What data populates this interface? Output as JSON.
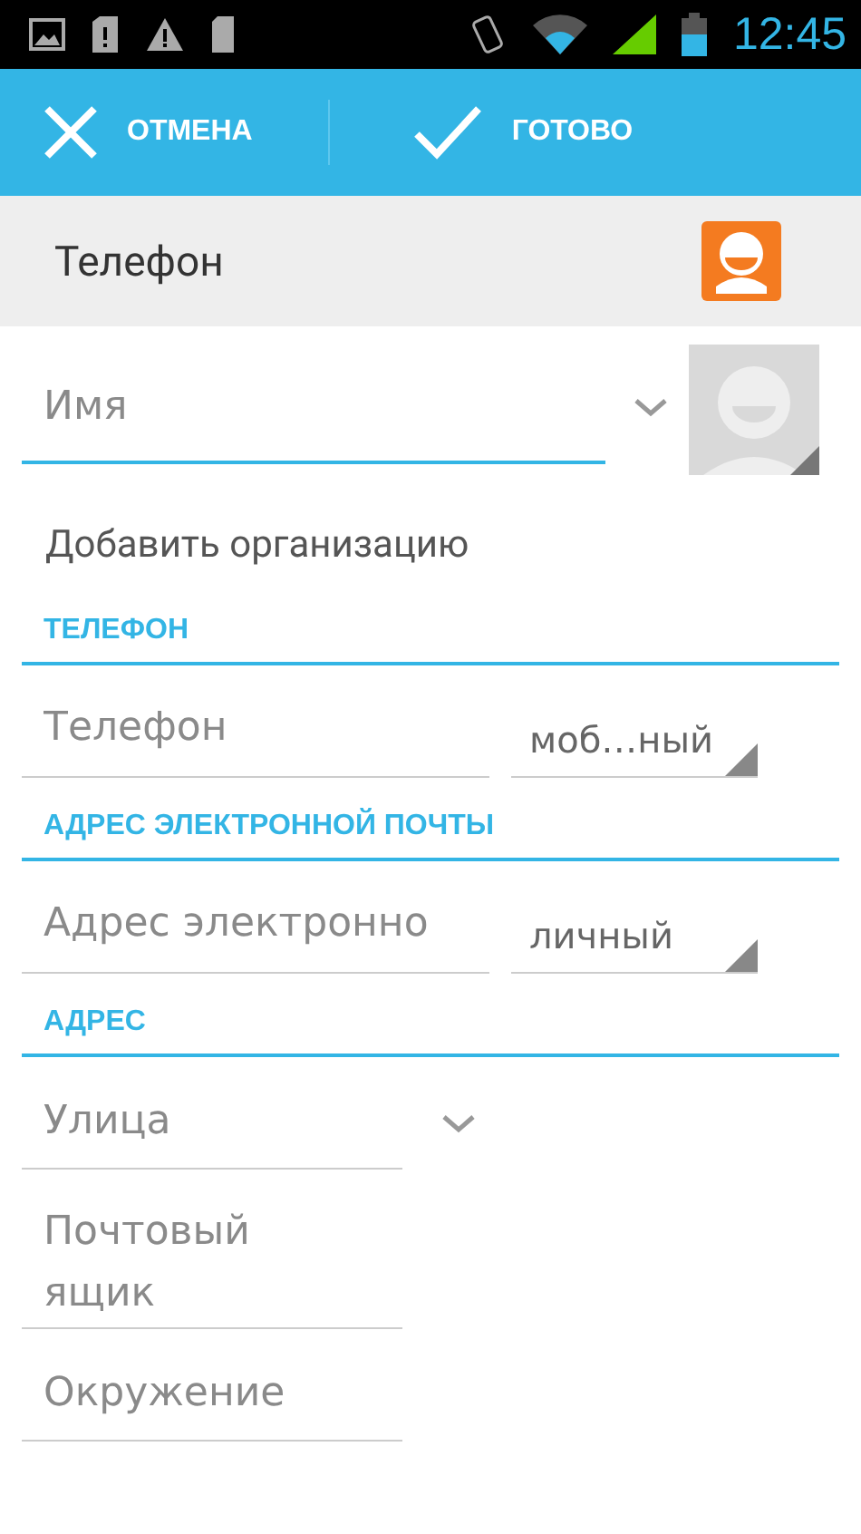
{
  "status_bar": {
    "time": "12:45"
  },
  "action_bar": {
    "cancel": "ОТМЕНА",
    "done": "ГОТОВО"
  },
  "account_header": {
    "title": "Телефон"
  },
  "name_field": {
    "placeholder": "Имя",
    "focused": true
  },
  "add_organization": "Добавить организацию",
  "sections": [
    {
      "title": "ТЕЛЕФОН",
      "fields": [
        {
          "kind": "spinner",
          "placeholder": "Телефон",
          "type": "моб…ный"
        }
      ]
    },
    {
      "title": "АДРЕС ЭЛЕКТРОННОЙ ПОЧТЫ",
      "fields": [
        {
          "kind": "spinner",
          "placeholder": "Адрес электронно",
          "type": "личный"
        }
      ]
    },
    {
      "title": "АДРЕС",
      "fields": [
        {
          "kind": "expand",
          "placeholder": "Улица"
        },
        {
          "kind": "multiline",
          "placeholder": "Почтовый ящик"
        },
        {
          "kind": "plain",
          "placeholder": "Окружение"
        }
      ]
    }
  ]
}
